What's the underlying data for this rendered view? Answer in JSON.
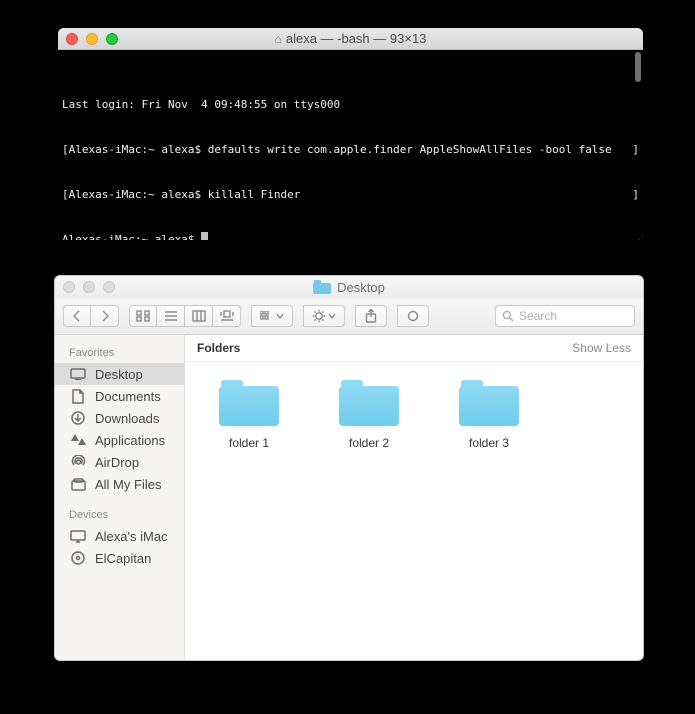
{
  "terminal": {
    "title": "alexa — -bash — 93×13",
    "lines": {
      "login": "Last login: Fri Nov  4 09:48:55 on ttys000",
      "l1_prompt": "Alexas-iMac:~ alexa$ ",
      "l1_cmd": "defaults write com.apple.finder AppleShowAllFiles -bool false",
      "l2_prompt": "Alexas-iMac:~ alexa$ ",
      "l2_cmd": "killall Finder",
      "l3_prompt": "Alexas-iMac:~ alexa$ ",
      "rbracket": "]"
    }
  },
  "finder": {
    "title": "Desktop",
    "search_placeholder": "Search",
    "sidebar": {
      "favorites_head": "Favorites",
      "devices_head": "Devices",
      "items": [
        {
          "label": "Desktop"
        },
        {
          "label": "Documents"
        },
        {
          "label": "Downloads"
        },
        {
          "label": "Applications"
        },
        {
          "label": "AirDrop"
        },
        {
          "label": "All My Files"
        }
      ],
      "devices": [
        {
          "label": "Alexa's iMac"
        },
        {
          "label": "ElCapitan"
        }
      ]
    },
    "group": {
      "name": "Folders",
      "toggle": "Show Less"
    },
    "folders": [
      {
        "name": "folder 1"
      },
      {
        "name": "folder 2"
      },
      {
        "name": "folder 3"
      }
    ]
  }
}
